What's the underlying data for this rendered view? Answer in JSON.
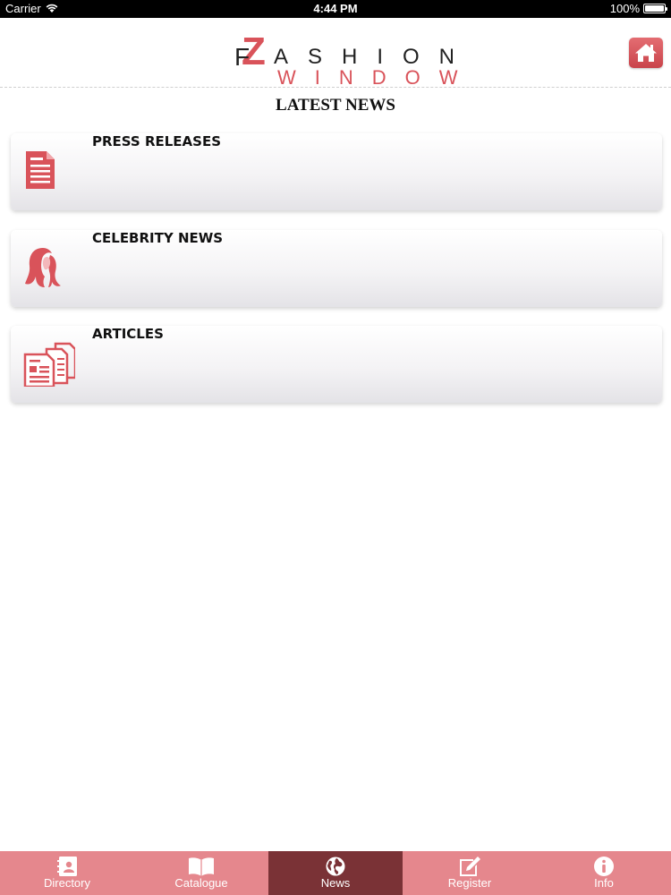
{
  "status_bar": {
    "carrier": "Carrier",
    "time": "4:44 PM",
    "battery": "100%"
  },
  "header": {
    "logo": {
      "line1": "ASHION",
      "line2": "WINDOW",
      "f_letter": "F",
      "z_letter": "Z"
    },
    "home_icon": "home-icon"
  },
  "page_title": "LATEST NEWS",
  "news_items": [
    {
      "label": "PRESS RELEASES",
      "icon": "document-icon"
    },
    {
      "label": "CELEBRITY NEWS",
      "icon": "woman-silhouette-icon"
    },
    {
      "label": "ARTICLES",
      "icon": "articles-icon"
    }
  ],
  "tab_bar": {
    "tabs": [
      {
        "label": "Directory",
        "icon": "directory-icon",
        "active": false
      },
      {
        "label": "Catalogue",
        "icon": "book-icon",
        "active": false
      },
      {
        "label": "News",
        "icon": "globe-icon",
        "active": true
      },
      {
        "label": "Register",
        "icon": "edit-icon",
        "active": false
      },
      {
        "label": "Info",
        "icon": "info-icon",
        "active": false
      }
    ]
  },
  "colors": {
    "accent": "#d9535a",
    "tab_bg": "#e5878d",
    "tab_active": "#7a3236"
  }
}
